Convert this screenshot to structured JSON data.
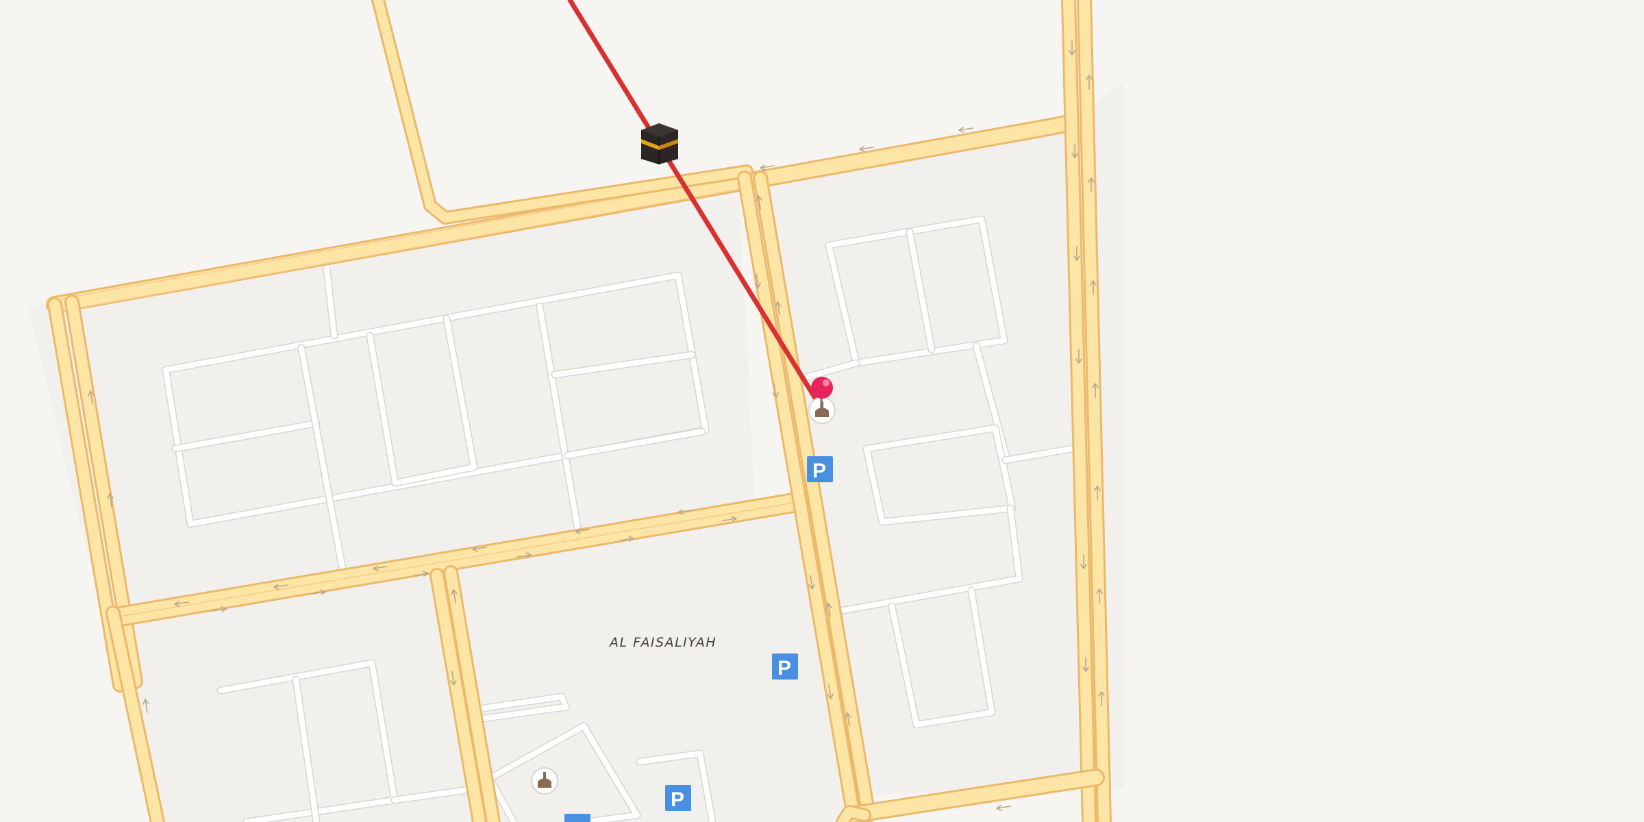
{
  "map": {
    "neighborhood_label": "AL FAISALIYAH",
    "parking_label": "P",
    "colors": {
      "background": "#f7f5f2",
      "road_fill": "#fde5a6",
      "road_outline": "#ecb86a",
      "route_line": "#d93030",
      "pin": "#e8245f",
      "parking": "#4a90e2",
      "mosque_icon": "#8a6a52"
    },
    "markers": {
      "kaaba": {
        "icon": "kaaba-icon"
      },
      "pin": {
        "icon": "map-pin-icon"
      },
      "mosques": [
        "mosque-icon",
        "mosque-icon"
      ],
      "parking": [
        "parking-icon",
        "parking-icon",
        "parking-icon",
        "parking-icon"
      ]
    }
  }
}
